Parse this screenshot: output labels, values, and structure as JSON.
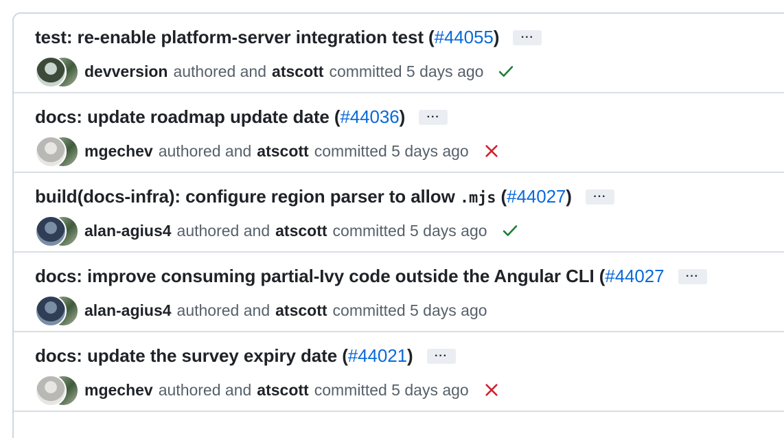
{
  "commits": [
    {
      "title_prefix": "test: re-enable platform-server integration test (",
      "title_code": "",
      "title_suffix": "",
      "pr_number": "#44055",
      "close_paren": ")",
      "more_label": "···",
      "author": "devversion",
      "authored_text": "authored and",
      "committer": "atscott",
      "committed_text": "committed 5 days ago",
      "status": "success",
      "author_avatar_colors": [
        "#3d4a3a",
        "#c9d6cf"
      ]
    },
    {
      "title_prefix": "docs: update roadmap update date (",
      "title_code": "",
      "title_suffix": "",
      "pr_number": "#44036",
      "close_paren": ")",
      "more_label": "···",
      "author": "mgechev",
      "authored_text": "authored and",
      "committer": "atscott",
      "committed_text": "committed 5 days ago",
      "status": "failure",
      "author_avatar_colors": [
        "#b8b8b5",
        "#e8e6e2"
      ]
    },
    {
      "title_prefix": "build(docs-infra): configure region parser to allow ",
      "title_code": ".mjs",
      "title_suffix": " (",
      "pr_number": "#44027",
      "close_paren": ")",
      "more_label": "···",
      "author": "alan-agius4",
      "authored_text": "authored and",
      "committer": "atscott",
      "committed_text": "committed 5 days ago",
      "status": "success",
      "author_avatar_colors": [
        "#2f3e55",
        "#7a8fa6"
      ]
    },
    {
      "title_prefix": "docs: improve consuming partial-Ivy code outside the Angular CLI (",
      "title_code": "",
      "title_suffix": "",
      "pr_number": "#44027",
      "close_paren": "",
      "more_label": "···",
      "author": "alan-agius4",
      "authored_text": "authored and",
      "committer": "atscott",
      "committed_text": "committed 5 days ago",
      "status": "none",
      "author_avatar_colors": [
        "#2f3e55",
        "#7a8fa6"
      ]
    },
    {
      "title_prefix": "docs: update the survey expiry date (",
      "title_code": "",
      "title_suffix": "",
      "pr_number": "#44021",
      "close_paren": ")",
      "more_label": "···",
      "author": "mgechev",
      "authored_text": "authored and",
      "committer": "atscott",
      "committed_text": "committed 5 days ago",
      "status": "failure",
      "author_avatar_colors": [
        "#b8b8b5",
        "#e8e6e2"
      ]
    }
  ],
  "committer_avatar_colors": [
    "#3f5a3c",
    "#a9b59a"
  ],
  "colors": {
    "success": "#1a7f37",
    "failure": "#cf222e",
    "link": "#0969da"
  },
  "icons": {
    "success": "check-icon",
    "failure": "x-icon"
  }
}
